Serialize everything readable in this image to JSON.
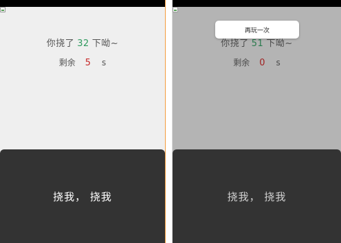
{
  "left_screen": {
    "count_prefix": "你挠了",
    "count_value": "32",
    "count_suffix": "下呦~",
    "remaining_label": "剩余",
    "remaining_value": "5",
    "remaining_unit": "s",
    "tap_button_label": "挠我， 挠我"
  },
  "right_screen": {
    "count_prefix": "你挠了",
    "count_value": "51",
    "count_suffix": "下呦~",
    "remaining_label": "剩余",
    "remaining_value": "0",
    "remaining_unit": "s",
    "tap_button_label": "挠我， 挠我",
    "replay_label": "再玩一次"
  },
  "colors": {
    "count_green": "#2f9a5e",
    "remaining_red": "#c62828",
    "panel_dark": "#333333",
    "left_background": "#efefef",
    "right_overlay_background": "#b4b4b4"
  }
}
